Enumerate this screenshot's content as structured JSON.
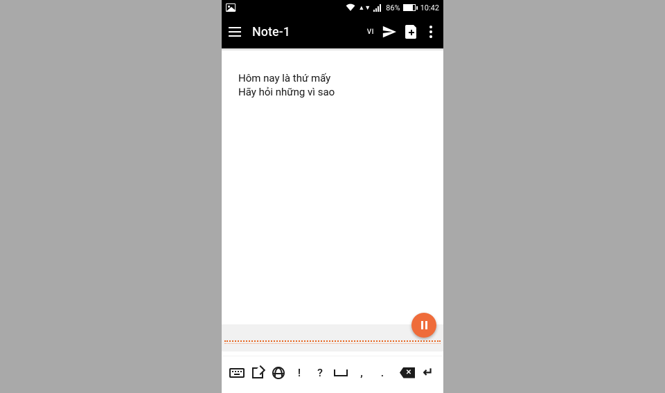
{
  "statusbar": {
    "battery_percent": "86%",
    "time": "10:42"
  },
  "appbar": {
    "title": "Note-1",
    "language": "VI"
  },
  "note": {
    "body": "Hôm nay là thứ mấy\nHãy hỏi những vì sao"
  },
  "toolbar": {
    "keys": {
      "exclaim": "!",
      "question": "?",
      "comma": ",",
      "period": ".",
      "backspace_x": "✕",
      "enter": "↵"
    }
  },
  "colors": {
    "accent": "#ef6c3a",
    "appbar_bg": "#000000",
    "page_bg": "#a9a9a9"
  }
}
